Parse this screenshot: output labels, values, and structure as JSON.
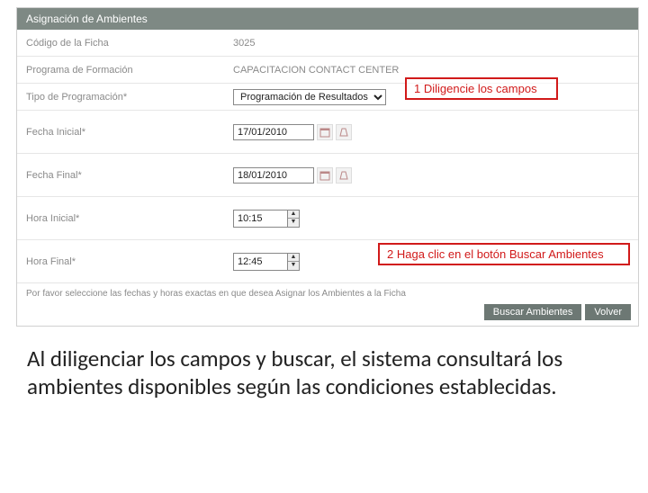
{
  "header": {
    "title": "Asignación de Ambientes"
  },
  "fields": {
    "codigo": {
      "label": "Código de la Ficha",
      "value": "3025"
    },
    "programa": {
      "label": "Programa de Formación",
      "value": "CAPACITACION CONTACT CENTER"
    },
    "tipo": {
      "label": "Tipo de Programación*",
      "value": "Programación de Resultados"
    },
    "fecha_inicial": {
      "label": "Fecha Inicial*",
      "value": "17/01/2010"
    },
    "fecha_final": {
      "label": "Fecha Final*",
      "value": "18/01/2010"
    },
    "hora_inicial": {
      "label": "Hora Inicial*",
      "value": "10:15"
    },
    "hora_final": {
      "label": "Hora Final*",
      "value": "12:45"
    }
  },
  "annotations": {
    "a1": "1 Diligencie los campos",
    "a2": "2 Haga clic en el botón Buscar Ambientes"
  },
  "footer_note": "Por favor seleccione las fechas y horas exactas en que desea Asignar los Ambientes a la Ficha",
  "buttons": {
    "buscar": "Buscar Ambientes",
    "volver": "Volver"
  },
  "caption": "Al diligenciar los campos y buscar, el sistema consultará los ambientes disponibles según las condiciones establecidas."
}
